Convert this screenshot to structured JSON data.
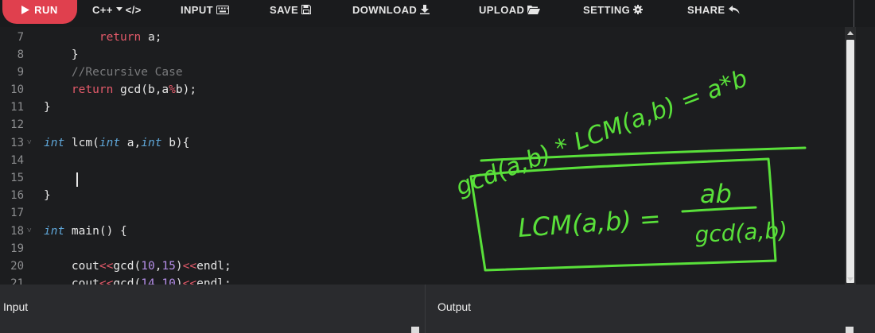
{
  "toolbar": {
    "run_label": "RUN",
    "language_label": "C++",
    "language_sub": "</>",
    "input_label": "INPUT",
    "save_label": "SAVE",
    "download_label": "DOWNLOAD",
    "upload_label": "UPLOAD",
    "setting_label": "SETTING",
    "share_label": "SHARE",
    "icons": {
      "run": "play-icon",
      "language": "chevron-down-icon",
      "input": "keyboard-icon",
      "save": "floppy-disk-icon",
      "download": "download-icon",
      "upload": "folder-open-icon",
      "setting": "gear-icon",
      "share": "share-icon"
    },
    "accent_color": "#e0404e"
  },
  "editor": {
    "line_numbers": [
      "7",
      "8",
      "9",
      "10",
      "11",
      "12",
      "13",
      "14",
      "15",
      "16",
      "17",
      "18",
      "19",
      "20",
      "21"
    ],
    "code": [
      "        return a;",
      "    }",
      "    //Recursive Case",
      "    return gcd(b,a%b);",
      "}",
      "",
      "int lcm(int a,int b){",
      "",
      "",
      "}",
      "",
      "int main() {",
      "",
      "    cout<<gcd(10,15)<<endl;",
      "    cout<<gcd(14,10)<<endl;"
    ]
  },
  "annotation": {
    "top_formula": "gcd(a,b) * LCM(a,b) = a*b",
    "boxed_formula_left": "LCM(a,b) =",
    "boxed_numerator": "ab",
    "boxed_denominator": "gcd(a,b)",
    "ink_color": "#59e03a"
  },
  "panels": {
    "input_title": "Input",
    "output_title": "Output"
  }
}
